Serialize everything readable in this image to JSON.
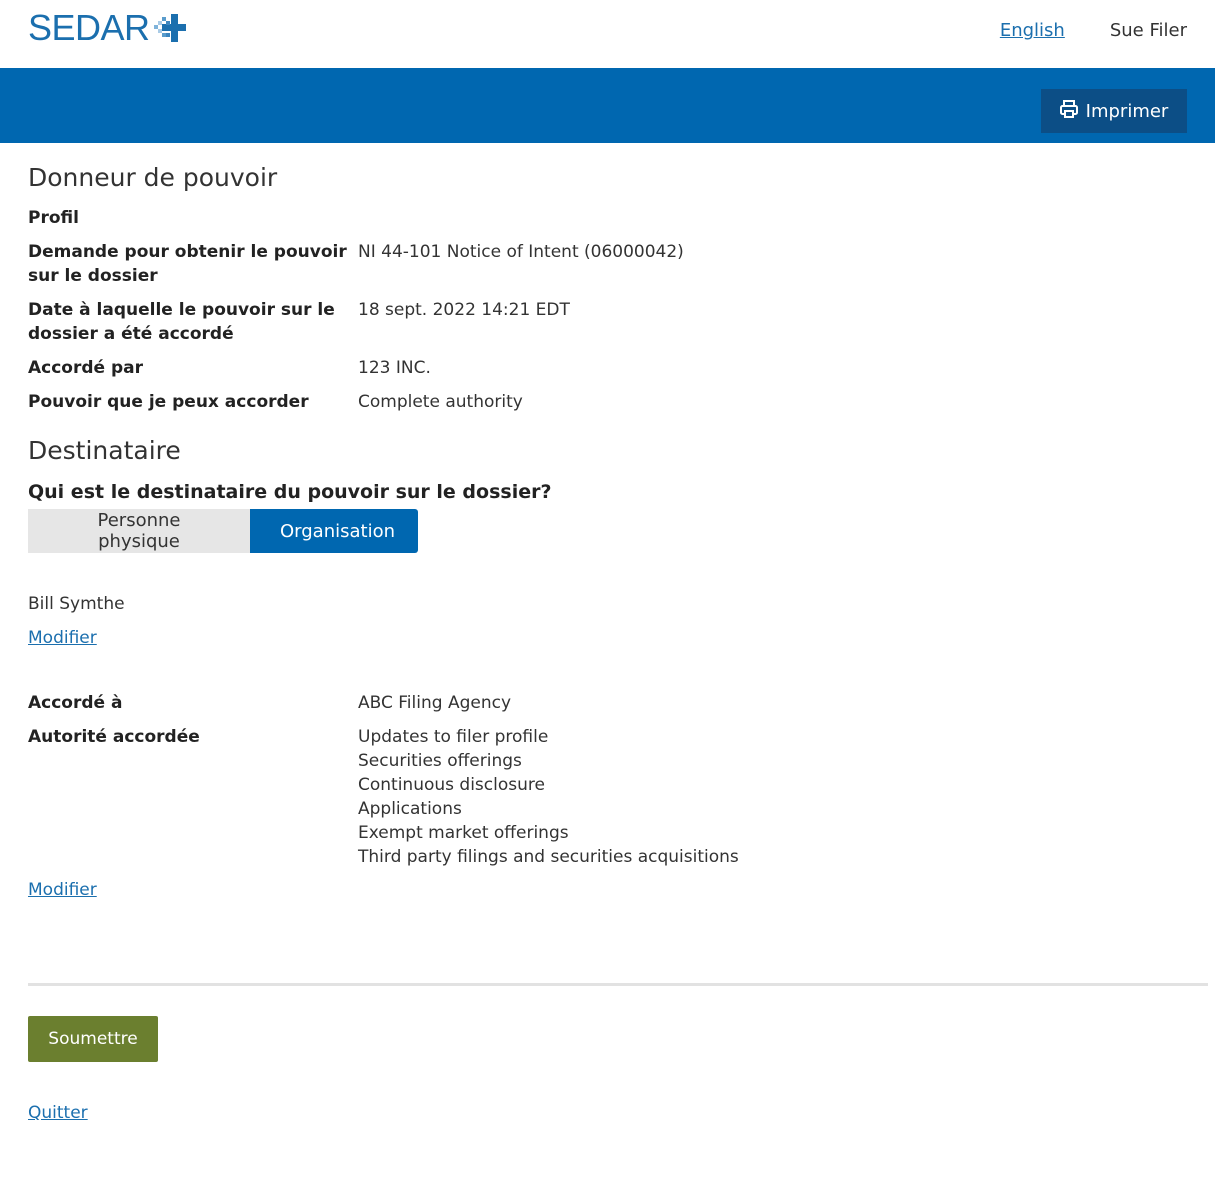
{
  "header": {
    "logo_text": "SEDAR",
    "language_link": "English",
    "user_name": "Sue Filer"
  },
  "toolbar": {
    "print_label": "Imprimer"
  },
  "donneur": {
    "title": "Donneur de pouvoir",
    "profile_label": "Profil",
    "rows": [
      {
        "label": "Demande pour obtenir le pouvoir sur le dossier",
        "value": "NI 44-101 Notice of Intent (06000042)"
      },
      {
        "label": "Date à laquelle le pouvoir sur le dossier a été accordé",
        "value": "18 sept. 2022 14:21 EDT"
      },
      {
        "label": "Accordé par",
        "value": "123 INC."
      },
      {
        "label": "Pouvoir que je peux accorder",
        "value": "Complete authority"
      }
    ]
  },
  "destinataire": {
    "title": "Destinataire",
    "question": "Qui est le destinataire du pouvoir sur le dossier?",
    "toggle": {
      "option_person": "Personne physique",
      "option_org": "Organisation",
      "selected": "Organisation"
    },
    "contact_name": "Bill Symthe",
    "modify_label_1": "Modifier",
    "granted_to_label": "Accordé à",
    "granted_to_value": "ABC Filing Agency",
    "authority_label": "Autorité accordée",
    "authorities": [
      "Updates to filer profile",
      "Securities offerings",
      "Continuous disclosure",
      "Applications",
      "Exempt market offerings",
      "Third party filings and securities acquisitions"
    ],
    "modify_label_2": "Modifier"
  },
  "footer": {
    "submit_label": "Soumettre",
    "quit_label": "Quitter"
  },
  "colors": {
    "brand_blue": "#0067b0",
    "dark_blue": "#0c4e86",
    "submit_green": "#6b7f2f"
  }
}
